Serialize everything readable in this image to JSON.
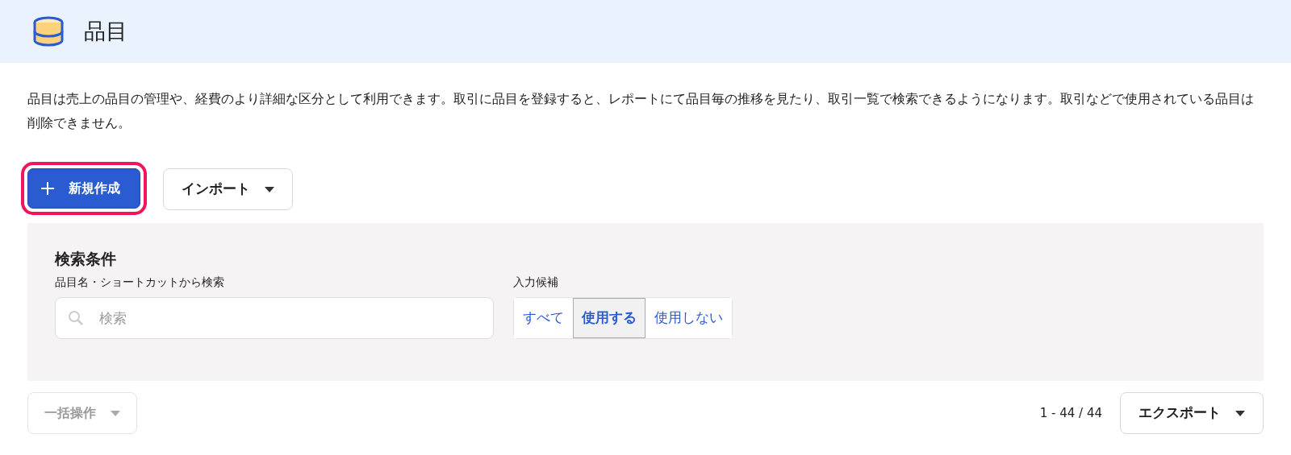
{
  "header": {
    "title": "品目"
  },
  "description": "品目は売上の品目の管理や、経費のより詳細な区分として利用できます。取引に品目を登録すると、レポートにて品目毎の推移を見たり、取引一覧で検索できるようになります。取引などで使用されている品目は削除できません。",
  "actions": [
    {
      "kind": "primary",
      "label": "新規作成",
      "highlighted": true
    },
    {
      "kind": "dropdown",
      "label": "インポート",
      "highlighted": false
    }
  ],
  "search_panel": {
    "title": "検索条件",
    "search": {
      "label": "品目名・ショートカットから検索",
      "placeholder": "検索"
    },
    "filter": {
      "label": "入力候補",
      "options": [
        {
          "label": "すべて",
          "selected": false
        },
        {
          "label": "使用する",
          "selected": true
        },
        {
          "label": "使用しない",
          "selected": false
        }
      ]
    }
  },
  "footer": {
    "bulk": {
      "label": "一括操作",
      "disabled": true
    },
    "count": "1 - 44 / 44",
    "export": {
      "label": "エクスポート"
    }
  }
}
